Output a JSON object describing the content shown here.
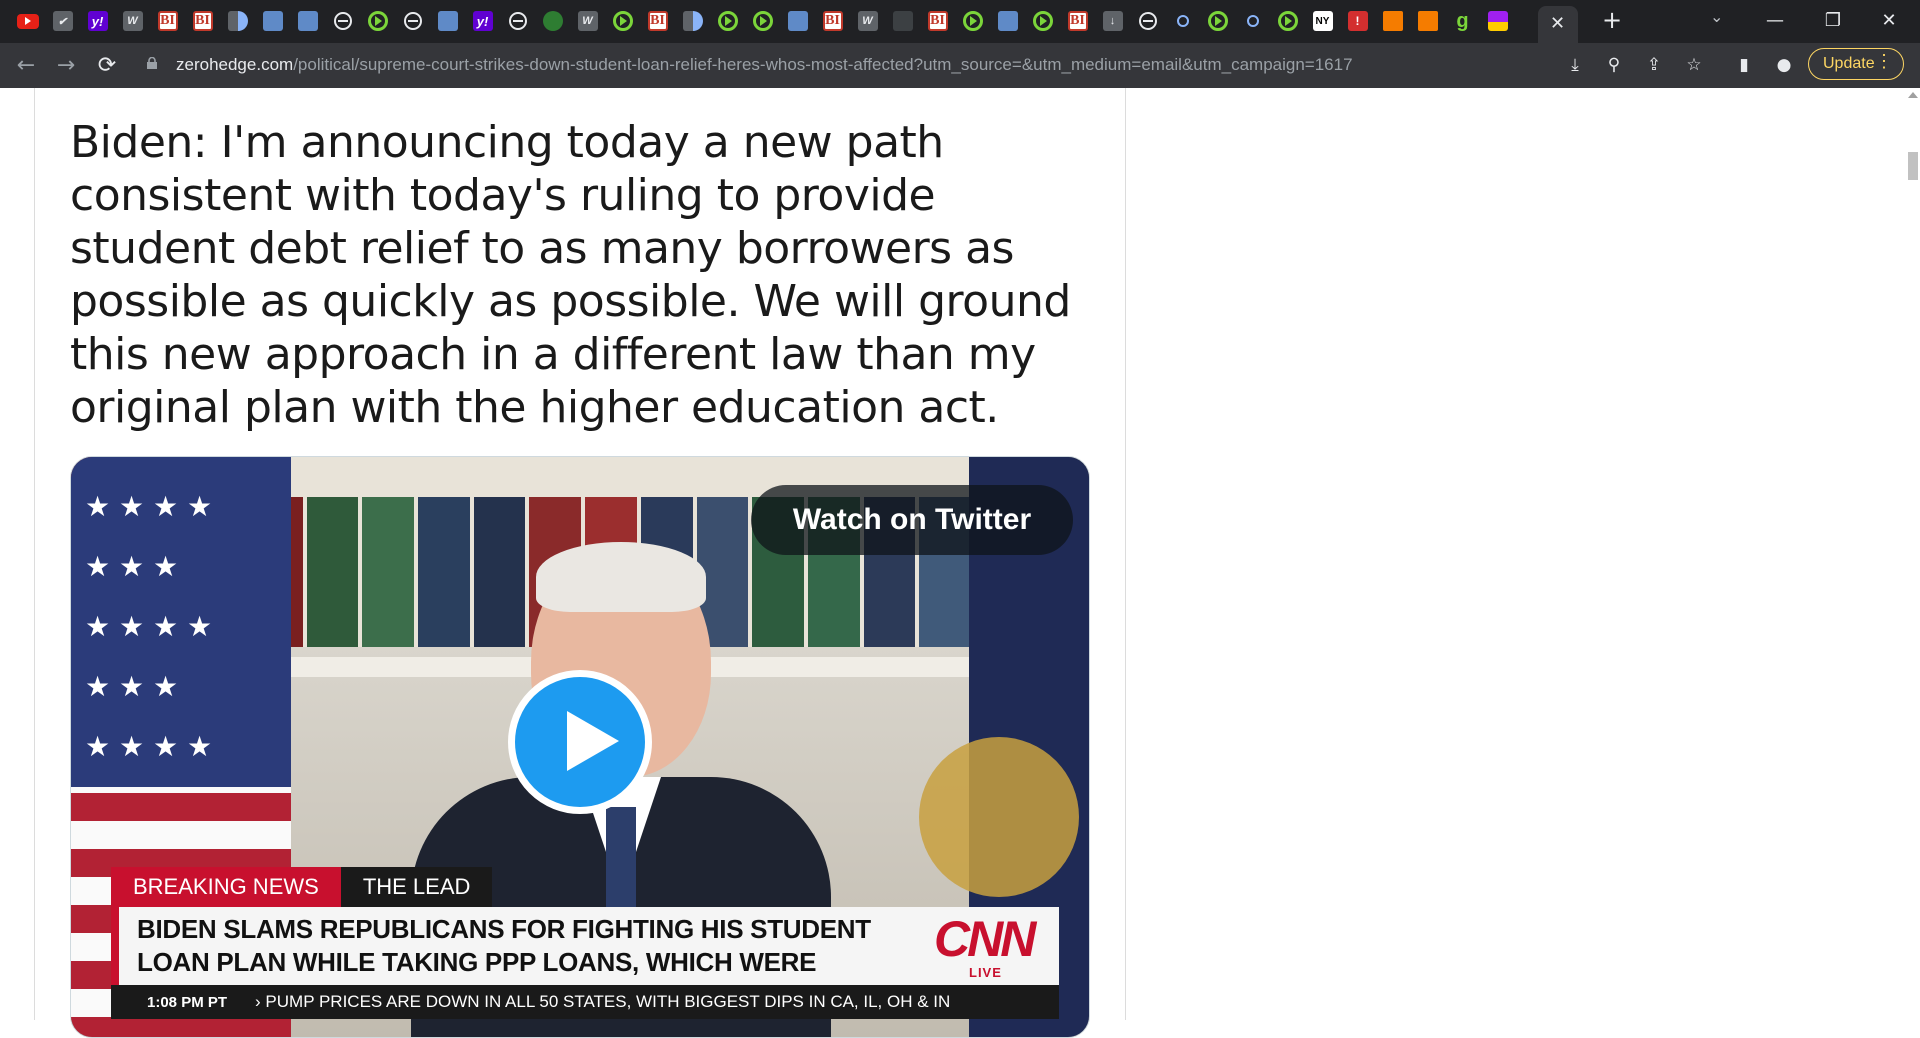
{
  "browser": {
    "tabs": [
      {
        "icon": "youtube-icon",
        "style": "yt",
        "label": ""
      },
      {
        "icon": "fingerprint-icon",
        "style": "gray",
        "label": "✔"
      },
      {
        "icon": "yahoo-icon",
        "style": "yahoo",
        "label": "y!"
      },
      {
        "icon": "wall-street-icon",
        "style": "gray",
        "label": "W"
      },
      {
        "icon": "business-insider-icon",
        "style": "bi",
        "label": "BI"
      },
      {
        "icon": "business-insider-icon",
        "style": "bi",
        "label": "BI"
      },
      {
        "icon": "half-moon-icon",
        "style": "half",
        "label": ""
      },
      {
        "icon": "arrow-tab-icon",
        "style": "tile",
        "label": ""
      },
      {
        "icon": "grid-tile-icon",
        "style": "tile",
        "label": ""
      },
      {
        "icon": "globe-icon",
        "style": "globe",
        "label": ""
      },
      {
        "icon": "rumble-play-icon",
        "style": "play",
        "label": ""
      },
      {
        "icon": "globe-icon",
        "style": "globe",
        "label": ""
      },
      {
        "icon": "arrow-tab-icon",
        "style": "tile",
        "label": ""
      },
      {
        "icon": "yahoo-icon",
        "style": "yahoo",
        "label": "y!"
      },
      {
        "icon": "globe-icon",
        "style": "globe",
        "label": ""
      },
      {
        "icon": "financial-times-icon",
        "style": "ft",
        "label": ""
      },
      {
        "icon": "wall-street-icon",
        "style": "gray",
        "label": "W"
      },
      {
        "icon": "rumble-play-icon",
        "style": "play",
        "label": ""
      },
      {
        "icon": "business-insider-icon",
        "style": "bi",
        "label": "BI"
      },
      {
        "icon": "half-moon-icon",
        "style": "half",
        "label": ""
      },
      {
        "icon": "rumble-play-icon",
        "style": "play",
        "label": ""
      },
      {
        "icon": "rumble-play-icon",
        "style": "play",
        "label": ""
      },
      {
        "icon": "arrow-tab-icon",
        "style": "tile",
        "label": ""
      },
      {
        "icon": "business-insider-icon",
        "style": "bi",
        "label": "BI"
      },
      {
        "icon": "wall-street-icon",
        "style": "gray",
        "label": "W"
      },
      {
        "icon": "dark-tab-icon",
        "style": "dark",
        "label": ""
      },
      {
        "icon": "business-insider-icon",
        "style": "bi",
        "label": "BI"
      },
      {
        "icon": "rumble-play-icon",
        "style": "play",
        "label": ""
      },
      {
        "icon": "arrow-tab-icon",
        "style": "tile",
        "label": ""
      },
      {
        "icon": "rumble-play-icon",
        "style": "play",
        "label": ""
      },
      {
        "icon": "business-insider-icon",
        "style": "bi",
        "label": "BI"
      },
      {
        "icon": "download-tab-icon",
        "style": "gray",
        "label": "↓"
      },
      {
        "icon": "globe-icon",
        "style": "globe",
        "label": ""
      },
      {
        "icon": "search-tab-icon",
        "style": "search",
        "label": ""
      },
      {
        "icon": "rumble-play-icon",
        "style": "play",
        "label": ""
      },
      {
        "icon": "search-tab-icon",
        "style": "search",
        "label": ""
      },
      {
        "icon": "rumble-play-icon",
        "style": "play",
        "label": ""
      },
      {
        "icon": "news-tab-icon",
        "style": "tw",
        "label": "NY"
      },
      {
        "icon": "red-alert-icon",
        "style": "red",
        "label": "!"
      },
      {
        "icon": "bookmark-orange-icon",
        "style": "orange",
        "label": ""
      },
      {
        "icon": "bookmark-orange-icon",
        "style": "orange",
        "label": ""
      },
      {
        "icon": "g-letter-icon",
        "style": "green",
        "label": "g"
      },
      {
        "icon": "flag-tab-icon",
        "style": "purpflag",
        "label": ""
      }
    ],
    "active_tab_close": "✕",
    "new_tab": "+",
    "tab_search": "⌄",
    "window": {
      "minimize": "—",
      "maximize": "❐",
      "close": "✕"
    },
    "nav": {
      "back": "←",
      "forward": "→",
      "reload": "⟳"
    },
    "url": {
      "domain": "zerohedge.com",
      "path": "/political/supreme-court-strikes-down-student-loan-relief-heres-whos-most-affected?utm_source=&utm_medium=email&utm_campaign=1617"
    },
    "toolbar_icons": [
      "install-icon",
      "zoom-icon",
      "share-icon",
      "bookmark-star-icon",
      "side-panel-icon",
      "profile-icon"
    ],
    "update_label": "Update",
    "update_menu": "⋮"
  },
  "article": {
    "quote": "Biden: I'm announcing today a new path consistent with today's ruling to provide student debt relief to as many borrowers as possible as quickly as possible. We will ground this new approach in a different law than my original plan with the higher education act.",
    "video": {
      "watch_label": "Watch on Twitter",
      "breaking": "BREAKING NEWS",
      "show": "THE LEAD",
      "headline": "BIDEN SLAMS REPUBLICANS FOR FIGHTING HIS STUDENT LOAN PLAN WHILE TAKING PPP LOANS, WHICH WERE FORGIVEN",
      "network": "CNN",
      "live": "LIVE",
      "time": "1:08 PM PT",
      "ticker": "› PUMP PRICES ARE DOWN IN ALL 50 STATES, WITH BIGGEST DIPS IN CA, IL, OH & IN"
    }
  }
}
